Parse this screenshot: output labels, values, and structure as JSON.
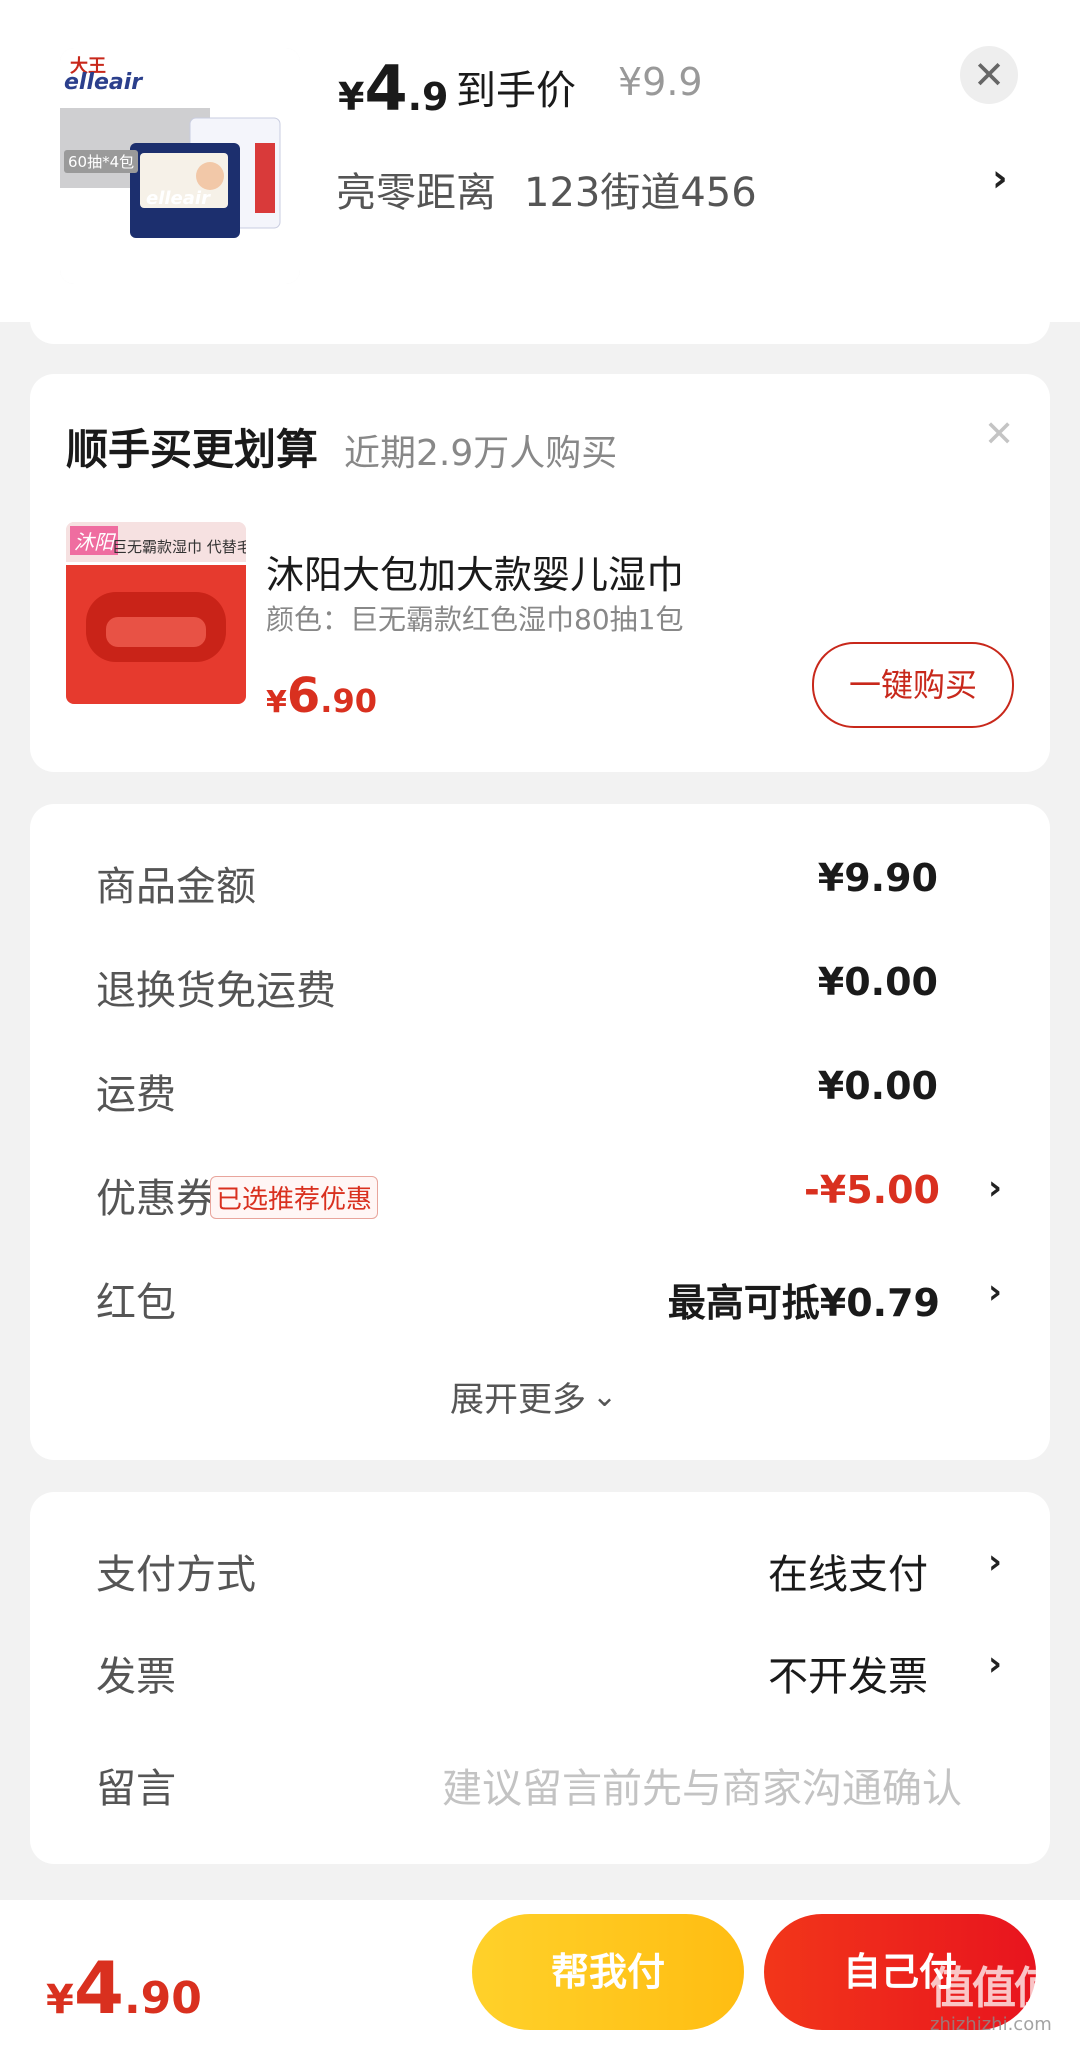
{
  "header": {
    "price_symbol": "¥",
    "price_int": "4",
    "price_dec": ".9",
    "price_label": "到手价",
    "original_price": "¥9.9",
    "address_name": "亮零距离",
    "address_detail": "123街道456",
    "chevron": "›",
    "close_icon": "✕",
    "product_image": {
      "brand_cn": "大王",
      "brand_en": "elleair",
      "pack_label": "60抽*4包"
    }
  },
  "upsell": {
    "title": "顺手买更划算",
    "subtitle": "近期2.9万人购买",
    "close_icon": "✕",
    "product_name": "沐阳大包加大款婴儿湿巾",
    "product_spec": "颜色：巨无霸款红色湿巾80抽1包",
    "price_symbol": "¥",
    "price_int": "6",
    "price_dec": ".90",
    "buy_button": "一键购买",
    "image": {
      "logo": "沐阳",
      "banner": "巨无霸款湿巾 代替毛巾"
    }
  },
  "summary": {
    "rows": [
      {
        "label": "商品金额",
        "value": "¥9.90"
      },
      {
        "label": "退换货免运费",
        "value": "¥0.00"
      },
      {
        "label": "运费",
        "value": "¥0.00"
      },
      {
        "label": "优惠券",
        "badge": "已选推荐优惠",
        "value": "-¥5.00"
      },
      {
        "label": "红包",
        "value": "最高可抵¥0.79"
      }
    ],
    "expand_more": "展开更多",
    "expand_icon": "⌄",
    "chevron": "›"
  },
  "payment": {
    "rows": [
      {
        "label": "支付方式",
        "value": "在线支付"
      },
      {
        "label": "发票",
        "value": "不开发票"
      },
      {
        "label": "留言",
        "placeholder": "建议留言前先与商家沟通确认"
      }
    ],
    "chevron": "›"
  },
  "bottom_bar": {
    "price_symbol": "¥",
    "price_int": "4",
    "price_dec": ".90",
    "help_pay_button": "帮我付",
    "self_pay_button": "自己付",
    "watermark_mark": "值值值",
    "watermark_url": "zhizhizhi.com"
  },
  "colors": {
    "accent_red": "#e8331f",
    "help_pay_yellow": "#ffc21a",
    "self_pay_red": "#f23b1c"
  }
}
